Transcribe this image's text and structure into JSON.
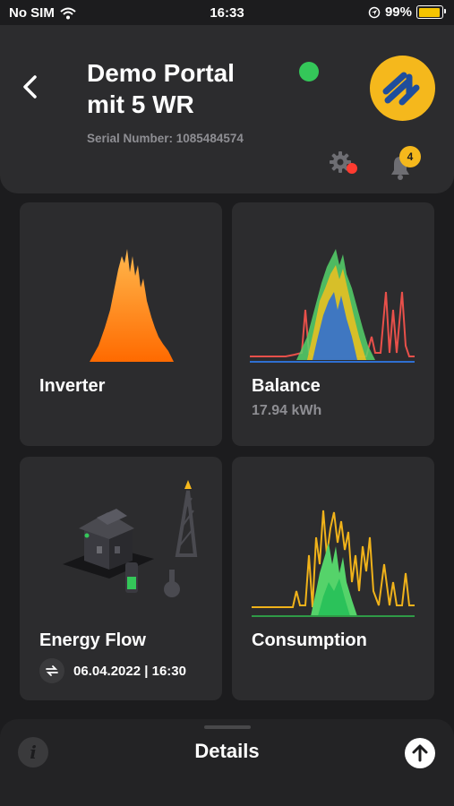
{
  "status_bar": {
    "carrier": "No SIM",
    "time": "16:33",
    "battery": "99%",
    "battery_level": 0.99
  },
  "header": {
    "title_line1": "Demo Portal",
    "title_line2": "mit 5 WR",
    "serial": "Serial Number: 1085484574",
    "notifications_count": "4"
  },
  "cards": {
    "inverter": {
      "label": "Inverter"
    },
    "balance": {
      "label": "Balance",
      "value": "17.94 kWh"
    },
    "energy_flow": {
      "label": "Energy Flow",
      "timestamp": "06.04.2022 | 16:30"
    },
    "consumption": {
      "label": "Consumption"
    }
  },
  "sheet": {
    "title": "Details"
  },
  "colors": {
    "accent": "#f5b81c",
    "online": "#34c759",
    "alert": "#ff3b30",
    "background": "#1c1c1e",
    "surface": "#2c2c2e"
  },
  "icons": [
    "wifi-icon",
    "location-icon",
    "battery-icon",
    "back-icon",
    "status-dot",
    "logo-icon",
    "settings-icon",
    "bell-icon",
    "refresh-icon",
    "info-icon",
    "arrow-up-icon"
  ]
}
